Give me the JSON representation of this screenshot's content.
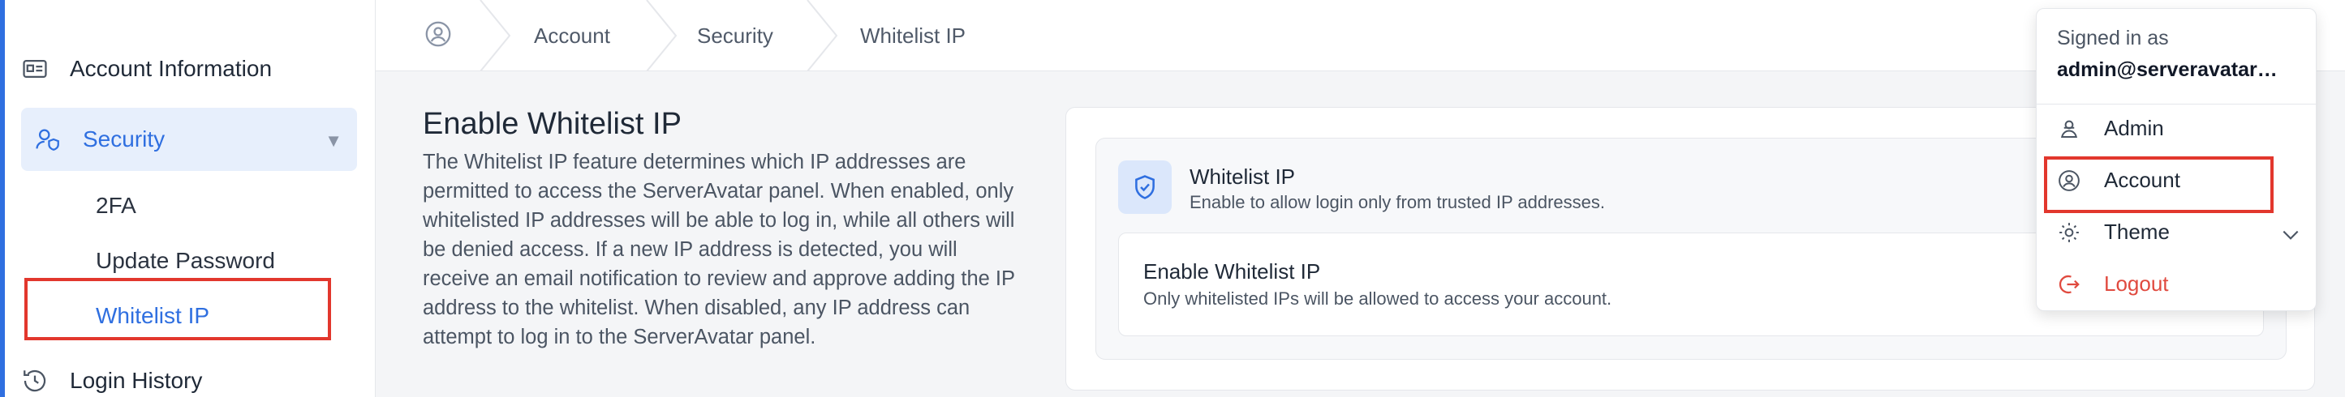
{
  "sidebar": {
    "account_information": "Account Information",
    "security": "Security",
    "sub_2fa": "2FA",
    "update_password": "Update Password",
    "whitelist_ip": "Whitelist IP",
    "login_history": "Login History"
  },
  "breadcrumb": {
    "items": [
      "Account",
      "Security",
      "Whitelist IP"
    ]
  },
  "main": {
    "title": "Enable Whitelist IP",
    "description": "The Whitelist IP feature determines which IP addresses are permitted to access the ServerAvatar panel. When enabled, only whitelisted IP addresses will be able to log in, while all others will be denied access. If a new IP address is detected, you will receive an email notification to review and approve adding the IP address to the whitelist. When disabled, any IP address can attempt to log in to the ServerAvatar panel.",
    "card_title": "Whitelist IP",
    "card_subtitle": "Enable to allow login only from trusted IP addresses.",
    "option_title": "Enable Whitelist IP",
    "option_subtitle": "Only whitelisted IPs will be allowed to access your account."
  },
  "user_menu": {
    "signed_in_label": "Signed in as",
    "email": "admin@serveravatar…",
    "items": [
      "Admin",
      "Account",
      "Theme",
      "Logout"
    ]
  },
  "colors": {
    "accent": "#2f6fe0",
    "highlight": "#e2372d",
    "logout": "#e04a3f"
  }
}
